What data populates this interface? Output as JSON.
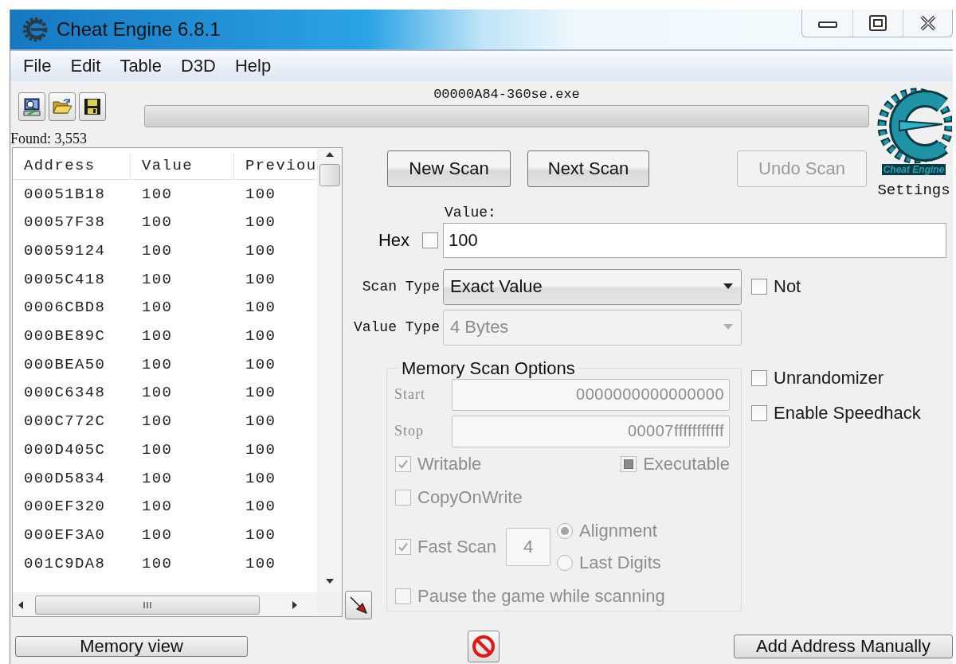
{
  "window": {
    "title": "Cheat Engine 6.8.1"
  },
  "menu": [
    "File",
    "Edit",
    "Table",
    "D3D",
    "Help"
  ],
  "toolbar": {
    "process": "00000A84-360se.exe",
    "progress": {
      "level": 0
    }
  },
  "found": "Found: 3,553",
  "results": {
    "columns": [
      "Address",
      "Value",
      "Previou"
    ],
    "rows": [
      [
        "00051B18",
        "100",
        "100"
      ],
      [
        "00057F38",
        "100",
        "100"
      ],
      [
        "00059124",
        "100",
        "100"
      ],
      [
        "0005C418",
        "100",
        "100"
      ],
      [
        "0006CBD8",
        "100",
        "100"
      ],
      [
        "000BE89C",
        "100",
        "100"
      ],
      [
        "000BEA50",
        "100",
        "100"
      ],
      [
        "000C6348",
        "100",
        "100"
      ],
      [
        "000C772C",
        "100",
        "100"
      ],
      [
        "000D405C",
        "100",
        "100"
      ],
      [
        "000D5834",
        "100",
        "100"
      ],
      [
        "000EF320",
        "100",
        "100"
      ],
      [
        "000EF3A0",
        "100",
        "100"
      ],
      [
        "001C9DA8",
        "100",
        "100"
      ]
    ]
  },
  "scan_buttons": [
    {
      "label": "New Scan",
      "disabled": false
    },
    {
      "label": "Next Scan",
      "disabled": false
    },
    {
      "label": "Undo Scan",
      "disabled": true
    }
  ],
  "logo": {
    "caption": "Cheat Engine"
  },
  "settings": "Settings",
  "value": {
    "label": "Value:",
    "hex": {
      "label": "Hex",
      "checked": false
    },
    "value": "100"
  },
  "scan_type": {
    "label": "Scan Type",
    "value": "Exact Value",
    "disabled": false
  },
  "value_type": {
    "label": "Value Type",
    "value": "4 Bytes",
    "disabled": true
  },
  "not": {
    "label": "Not",
    "checked": false
  },
  "memory_scan_options": {
    "title": "Memory Scan Options",
    "disabled": true,
    "start": {
      "label": "Start",
      "value": "0000000000000000"
    },
    "stop": {
      "label": "Stop",
      "value": "00007fffffffffff"
    },
    "writable": {
      "label": "Writable",
      "checked": true
    },
    "executable": {
      "label": "Executable",
      "checked": false,
      "indeterminate": true
    },
    "copy_on_write": {
      "label": "CopyOnWrite",
      "checked": false
    },
    "fast_scan": {
      "label": "Fast Scan",
      "checked": true,
      "value": "4"
    },
    "alignment_options": [
      {
        "label": "Alignment",
        "selected": true
      },
      {
        "label": "Last Digits",
        "selected": false
      }
    ],
    "pause": {
      "label": "Pause the game while scanning",
      "checked": false
    }
  },
  "side_options": [
    {
      "label": "Unrandomizer",
      "checked": false
    },
    {
      "label": "Enable Speedhack",
      "checked": false
    }
  ],
  "bottom": {
    "memory_view": "Memory view",
    "add_address": "Add Address Manually"
  }
}
